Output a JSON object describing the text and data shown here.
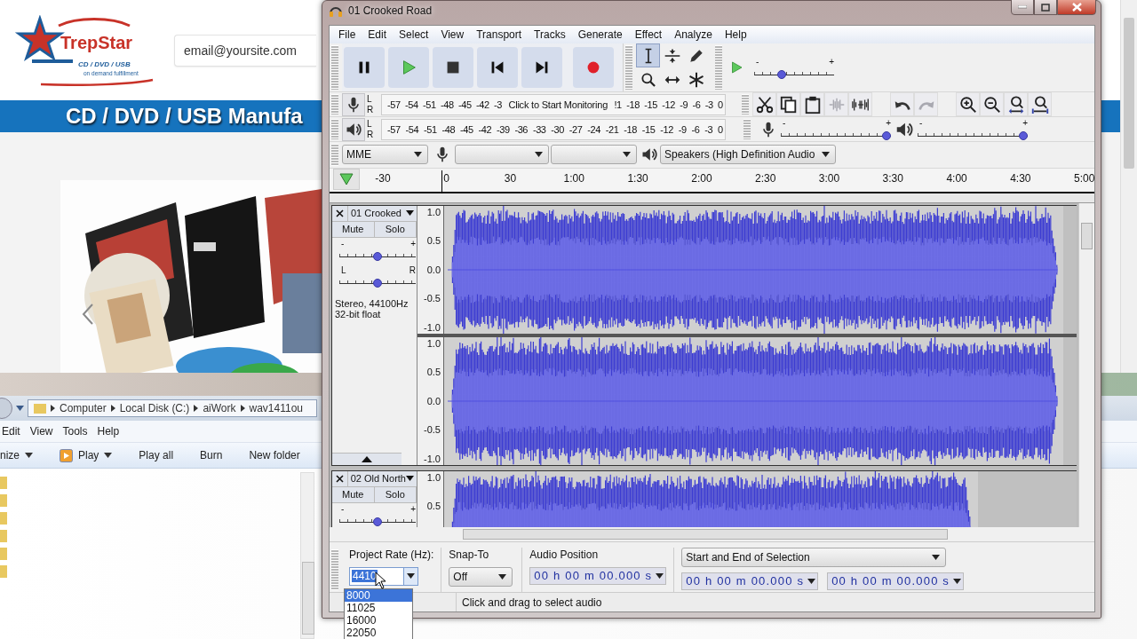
{
  "browser": {
    "logo_name": "TrepStar",
    "logo_line": "CD / DVD / USB",
    "logo_tagline": "on demand fulfillment",
    "email": "email@yoursite.com",
    "banner": "CD / DVD / USB Manufa"
  },
  "explorer": {
    "path": [
      "Computer",
      "Local Disk (C:)",
      "aiWork",
      "wav1411ou"
    ],
    "menu": [
      "Edit",
      "View",
      "Tools",
      "Help"
    ],
    "toolbar": [
      {
        "label": "nize",
        "dropdown": true,
        "kind": "text"
      },
      {
        "label": "Play",
        "dropdown": true,
        "kind": "play"
      },
      {
        "label": "Play all",
        "dropdown": false,
        "kind": "text"
      },
      {
        "label": "Burn",
        "dropdown": false,
        "kind": "text"
      },
      {
        "label": "New folder",
        "dropdown": false,
        "kind": "text"
      }
    ]
  },
  "audacity": {
    "title": "01 Crooked Road",
    "menu": [
      "File",
      "Edit",
      "Select",
      "View",
      "Transport",
      "Tracks",
      "Generate",
      "Effect",
      "Analyze",
      "Help"
    ],
    "transport": [
      {
        "kind": "pause"
      },
      {
        "kind": "play"
      },
      {
        "kind": "stop"
      },
      {
        "kind": "skip-start"
      },
      {
        "kind": "skip-end"
      },
      {
        "kind": "record"
      }
    ],
    "tools": [
      {
        "kind": "select",
        "selected": true
      },
      {
        "kind": "envelope",
        "selected": false
      },
      {
        "kind": "draw",
        "selected": false
      },
      {
        "kind": "zoom",
        "selected": false
      },
      {
        "kind": "timeshift",
        "selected": false
      },
      {
        "kind": "multi",
        "selected": false
      }
    ],
    "play_speed": {
      "min": "-",
      "max": "+",
      "level": 0.33
    },
    "record_meter": {
      "channels": [
        "L",
        "R"
      ],
      "ticks_before": [
        "-57",
        "-54",
        "-51",
        "-48",
        "-45",
        "-42",
        "-3"
      ],
      "hint": "Click to Start Monitoring",
      "ticks_after": [
        "!1",
        "-18",
        "-15",
        "-12",
        "-9",
        "-6",
        "-3",
        "0"
      ]
    },
    "playback_meter": {
      "channels": [
        "L",
        "R"
      ],
      "ticks": [
        "-57",
        "-54",
        "-51",
        "-48",
        "-45",
        "-42",
        "-39",
        "-36",
        "-33",
        "-30",
        "-27",
        "-24",
        "-21",
        "-18",
        "-15",
        "-12",
        "-9",
        "-6",
        "-3",
        "0"
      ]
    },
    "edit_tools": [
      {
        "kind": "cut",
        "disabled": false
      },
      {
        "kind": "copy",
        "disabled": false
      },
      {
        "kind": "paste",
        "disabled": false
      },
      {
        "kind": "trim",
        "disabled": true
      },
      {
        "kind": "silence",
        "disabled": false
      },
      {
        "kind": "undo",
        "disabled": false
      },
      {
        "kind": "redo",
        "disabled": true
      },
      {
        "kind": "zoom-in",
        "disabled": false
      },
      {
        "kind": "zoom-out",
        "disabled": false
      },
      {
        "kind": "fit-selection",
        "disabled": false
      },
      {
        "kind": "fit-project",
        "disabled": false
      }
    ],
    "mixer": {
      "input": {
        "min": "-",
        "max": "+",
        "level": 1
      },
      "output": {
        "min": "-",
        "max": "+",
        "level": 1
      }
    },
    "devices": {
      "host": "MME",
      "output": "Speakers (High Definition Audio"
    },
    "timeline": [
      "-30",
      "0",
      "30",
      "1:00",
      "1:30",
      "2:00",
      "2:30",
      "3:00",
      "3:30",
      "4:00",
      "4:30",
      "5:00"
    ],
    "tracks": [
      {
        "name": "01 Crooked",
        "mute": "Mute",
        "solo": "Solo",
        "gain": {
          "min": "-",
          "max": "+",
          "level": 0.5
        },
        "pan": {
          "min": "L",
          "max": "R",
          "level": 0.5
        },
        "info": [
          "Stereo, 44100Hz",
          "32-bit float"
        ],
        "channels": [
          {
            "scale": [
              "1.0",
              "0.5",
              "0.0",
              "-0.5",
              "-1.0"
            ]
          },
          {
            "scale": [
              "1.0",
              "0.5",
              "0.0",
              "-0.5",
              "-1.0"
            ]
          }
        ]
      },
      {
        "name": "02 Old North",
        "mute": "Mute",
        "solo": "Solo",
        "gain": {
          "min": "-",
          "max": "+",
          "level": 0.5
        },
        "channels": [
          {
            "scale": [
              "1.0",
              "0.5"
            ]
          }
        ]
      }
    ],
    "project_rate": {
      "label": "Project Rate (Hz):",
      "value": "4410",
      "options": [
        {
          "label": "8000",
          "selected": true
        },
        {
          "label": "11025",
          "selected": false
        },
        {
          "label": "16000",
          "selected": false
        },
        {
          "label": "22050",
          "selected": false
        }
      ]
    },
    "snap": {
      "label": "Snap-To",
      "value": "Off"
    },
    "position": {
      "label": "Audio Position",
      "value": "00 h 00 m 00.000 s"
    },
    "selection": {
      "mode": "Start and End of Selection",
      "start": "00 h 00 m 00.000 s",
      "end": "00 h 00 m 00.000 s"
    },
    "status": "Click and drag to select audio"
  }
}
